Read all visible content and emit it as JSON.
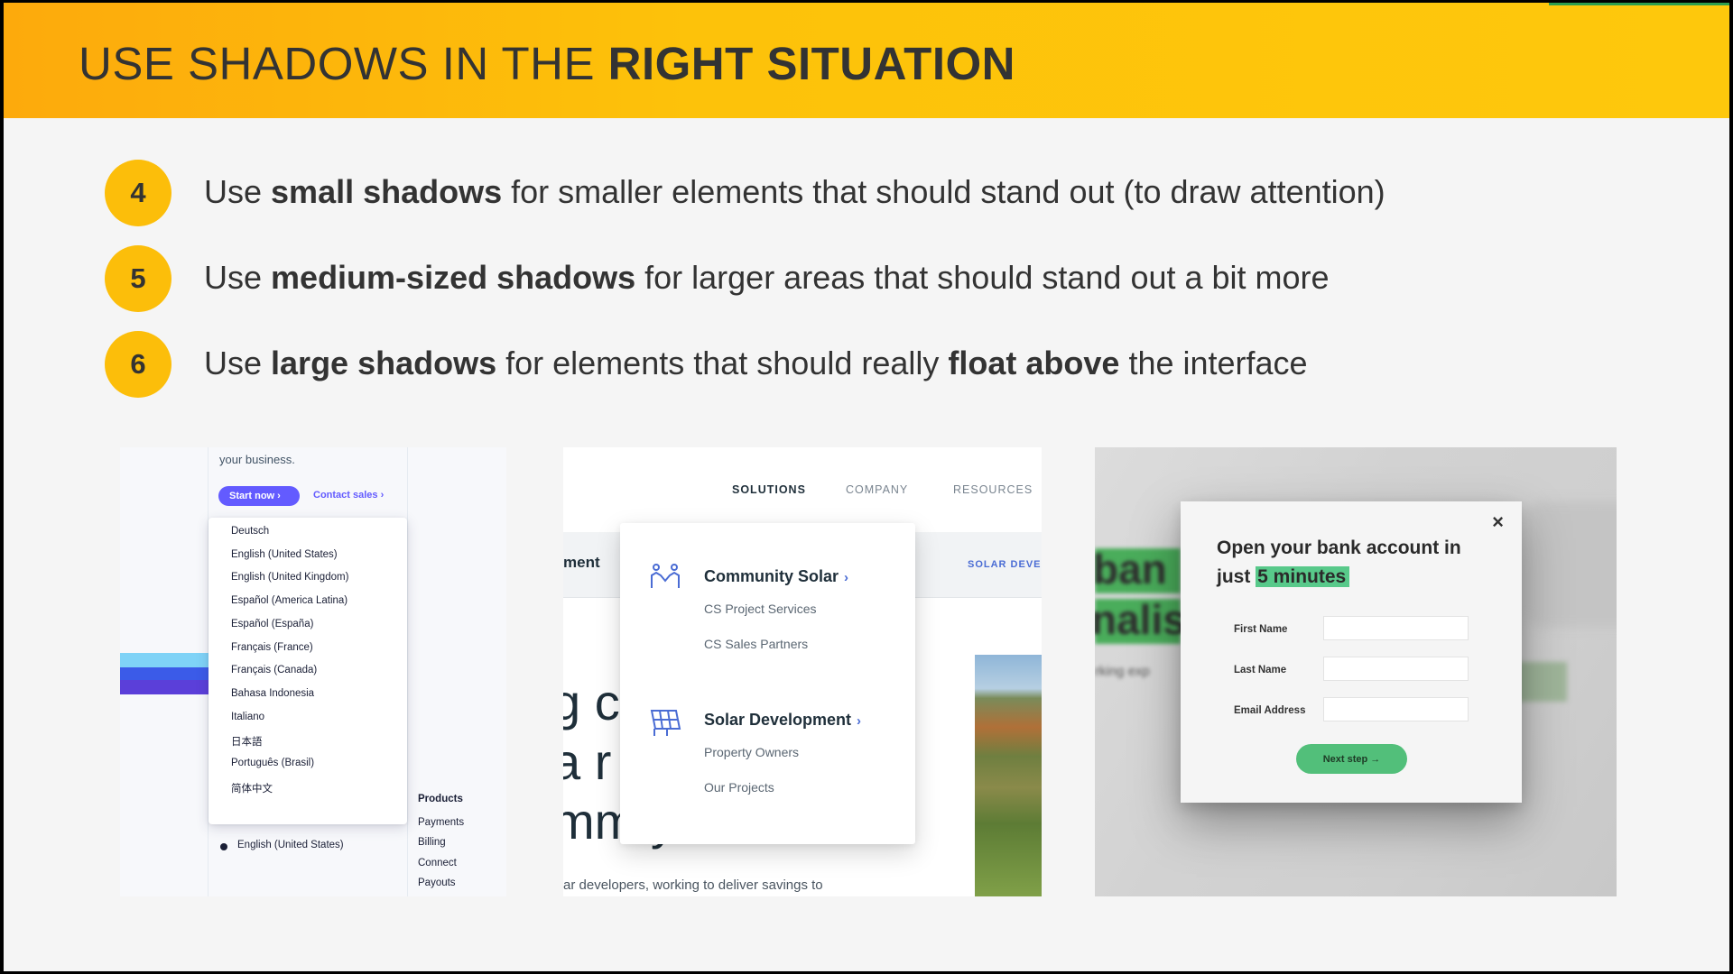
{
  "title": {
    "prefix": "USE SHADOWS IN THE ",
    "bold": "RIGHT SITUATION"
  },
  "points": [
    {
      "number": "4",
      "before": "Use ",
      "bold": "small shadows",
      "after": " for smaller elements that should stand out (to draw attention)"
    },
    {
      "number": "5",
      "before": "Use ",
      "bold": "medium-sized shadows",
      "after": " for larger areas that should stand out a bit more"
    },
    {
      "number": "6",
      "before": "Use ",
      "bold": "large shadows",
      "middle": " for elements that should really ",
      "bold2": "float above",
      "after": " the interface"
    }
  ],
  "panel1": {
    "intro": "your business.",
    "start_label": "Start now ›",
    "contact_label": "Contact sales ›",
    "languages": [
      "Deutsch",
      "English (United States)",
      "English (United Kingdom)",
      "Español (America Latina)",
      "Español (España)",
      "Français (France)",
      "Français (Canada)",
      "Bahasa Indonesia",
      "Italiano",
      "日本語",
      "Português (Brasil)",
      "简体中文"
    ],
    "selected_language": "English (United States)",
    "footer_heading": "Products",
    "footer_links": [
      "Payments",
      "Billing",
      "Connect",
      "Payouts"
    ]
  },
  "panel2": {
    "nav": [
      "SOLUTIONS",
      "COMPANY",
      "RESOURCES"
    ],
    "side_label": "SOLAR DEVEL",
    "partial_heading": "ment",
    "big_fragments": [
      "g cl",
      "a r",
      "mm   y"
    ],
    "bottom_text": "ar developers, working to deliver savings to",
    "sections": [
      {
        "heading": "Community Solar",
        "icon": "people-icon",
        "items": [
          "CS Project Services",
          "CS Sales Partners"
        ]
      },
      {
        "heading": "Solar Development",
        "icon": "solar-panel-icon",
        "items": [
          "Property Owners",
          "Our Projects"
        ]
      }
    ],
    "chevron": "›"
  },
  "panel3": {
    "bg_words": [
      "ban",
      "nalis",
      "rking exp"
    ],
    "title_prefix": "Open your bank account in just ",
    "title_highlight": "5 minutes",
    "close": "×",
    "fields": [
      "First Name",
      "Last Name",
      "Email Address"
    ],
    "button": "Next step →"
  },
  "colors": {
    "header_yellow": "#fec80c",
    "badge_yellow": "#fcbe0a",
    "stripe_purple": "#635bff",
    "green": "#52bf7a"
  }
}
